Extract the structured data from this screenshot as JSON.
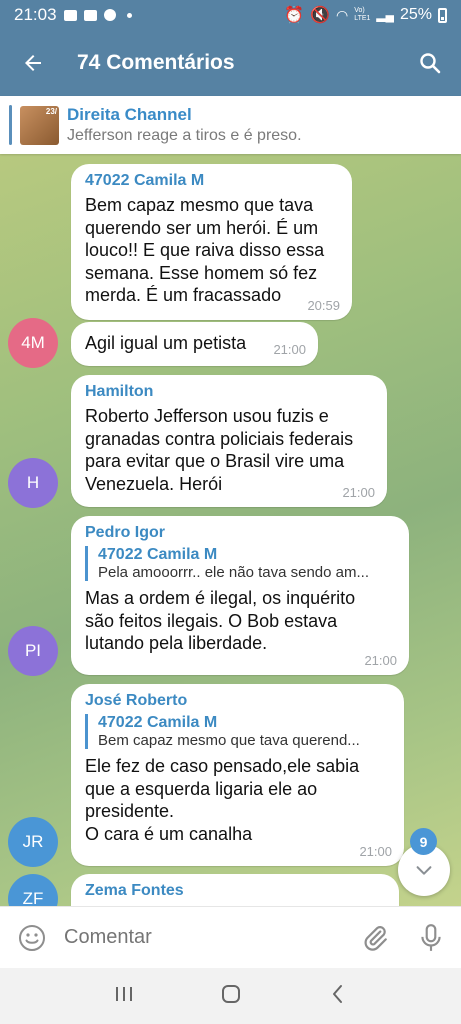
{
  "status": {
    "time": "21:03",
    "battery": "25%",
    "net_label": "Vo) LTE1"
  },
  "header": {
    "title": "74 Comentários"
  },
  "pinned": {
    "channel": "Direita Channel",
    "text": "Jefferson reage a tiros e é preso.",
    "thumb_badge": "23/"
  },
  "messages": [
    {
      "name": "47022 Camila M",
      "text": "Bem capaz mesmo que tava\nquerendo ser um herói. É um\nlouco!! E que raiva disso essa\nsemana.  Esse homem só fez\nmerda. É um fracassado",
      "time": "20:59"
    },
    {
      "avatar": "4M",
      "avatar_color": "#e56a86",
      "text": "Agil igual um petista",
      "time": "21:00"
    },
    {
      "name": "Hamilton",
      "avatar": "H",
      "avatar_color": "#8c72d8",
      "text": "Roberto Jefferson usou fuzis e\ngranadas contra policiais federais\npara evitar que o Brasil vire uma\nVenezuela. Herói",
      "time": "21:00"
    },
    {
      "name": "Pedro Igor",
      "avatar": "PI",
      "avatar_color": "#8c72d8",
      "reply_name": "47022 Camila M",
      "reply_text": "Pela amooorrr.. ele não tava sendo am...",
      "text": "Mas a ordem é ilegal, os inquérito\nsão feitos ilegais. O Bob estava\nlutando pela liberdade.",
      "time": "21:00"
    },
    {
      "name": "José Roberto",
      "avatar": "JR",
      "avatar_color": "#4a96d6",
      "reply_name": "47022 Camila M",
      "reply_text": "Bem capaz mesmo que tava querend...",
      "text": "Ele fez de caso pensado,ele sabia\nque a esquerda ligaria ele ao\npresidente.\nO cara é um canalha",
      "time": "21:00"
    },
    {
      "name": "Zema Fontes",
      "avatar": "ZF",
      "avatar_color": "#4a96d6"
    }
  ],
  "scroll": {
    "unread_count": "9"
  },
  "composer": {
    "placeholder": "Comentar"
  },
  "colors": {
    "header": "#5682a3",
    "accent": "#3c8ac2",
    "badge": "#4a96d6"
  },
  "icons": [
    "back-arrow-icon",
    "search-icon",
    "emoji-icon",
    "attach-icon",
    "mic-icon",
    "chevron-down-icon",
    "recent-apps-icon",
    "home-icon",
    "nav-back-icon"
  ]
}
